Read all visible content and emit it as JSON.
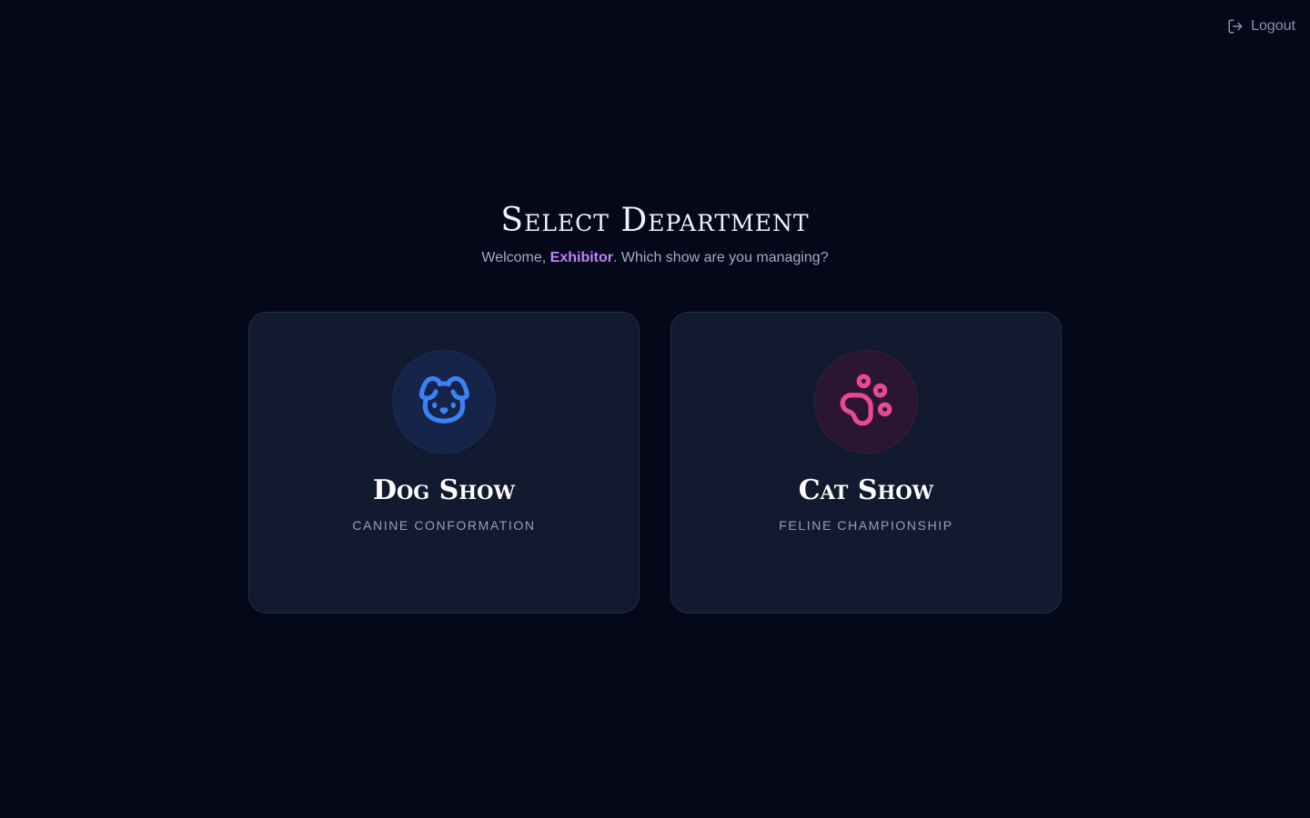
{
  "header": {
    "logout_label": "Logout",
    "logout_icon": "logout-icon"
  },
  "main": {
    "title": "Select Department",
    "welcome_prefix": "Welcome, ",
    "user_name": "Exhibitor",
    "welcome_suffix": ". Which show are you managing?"
  },
  "departments": [
    {
      "title": "Dog Show",
      "subtitle": "CANINE CONFORMATION",
      "icon": "dog-icon",
      "accent": "#3b82f6"
    },
    {
      "title": "Cat Show",
      "subtitle": "FELINE CHAMPIONSHIP",
      "icon": "paw-icon",
      "accent": "#ec4899"
    }
  ],
  "colors": {
    "background": "#040818",
    "card": "#111a2e",
    "user_highlight": "#c084fc"
  }
}
